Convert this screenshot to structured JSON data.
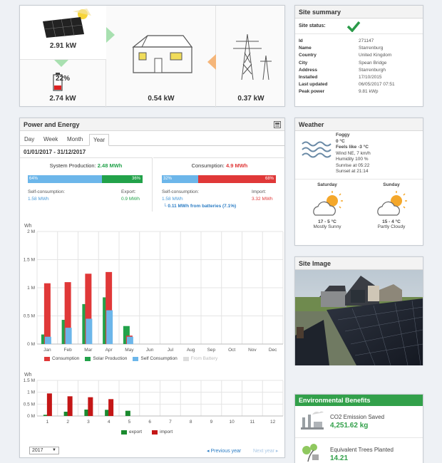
{
  "flow": {
    "solar_kw": "2.91 kW",
    "battery_pct": "22%",
    "battery_kw": "2.74 kW",
    "home_kw": "0.54 kW",
    "grid_kw": "0.37 kW"
  },
  "summary": {
    "title": "Site summary",
    "status_label": "Site status:",
    "rows": [
      {
        "k": "Id",
        "v": "271147"
      },
      {
        "k": "Name",
        "v": "Starrenburg"
      },
      {
        "k": "Country",
        "v": "United Kingdom"
      },
      {
        "k": "City",
        "v": "Spean Bridge"
      },
      {
        "k": "Address",
        "v": "Starrenburgh"
      },
      {
        "k": "Installed",
        "v": "17/10/2015"
      },
      {
        "k": "Last updated",
        "v": "06/05/2017 07:51"
      },
      {
        "k": "Peak power",
        "v": "9.81 kWp"
      }
    ]
  },
  "power": {
    "title": "Power and Energy",
    "tabs": [
      "Day",
      "Week",
      "Month",
      "Year"
    ],
    "date_range": "01/01/2017 - 31/12/2017",
    "production_label": "System Production:",
    "production_value": "2.48 MWh",
    "consumption_label": "Consumption:",
    "consumption_value": "4.9 MWh",
    "prod_split": [
      "64%",
      "36%"
    ],
    "cons_split": [
      "32%",
      "68%"
    ],
    "self_cons_label": "Self-consumption:",
    "self_cons_value": "1.58 MWh",
    "export_label": "Export:",
    "export_value": "0.9 MWh",
    "self_cons_label2": "Self-consumption:",
    "self_cons_value2": "1.58 MWh",
    "import_label": "Import:",
    "import_value": "3.32 MWh",
    "from_batteries": "0.11 MWh from batteries (7.1%)",
    "year_select": "2017",
    "prev_year": "Previous year",
    "next_year": "Next year"
  },
  "chart_data": [
    {
      "type": "bar",
      "ylabel": "Wh",
      "categories": [
        "Jan",
        "Feb",
        "Mar",
        "Apr",
        "May",
        "Jun",
        "Jul",
        "Aug",
        "Sep",
        "Oct",
        "Nov",
        "Dec"
      ],
      "yticks": [
        "0 M",
        "0.5 M",
        "1 M",
        "1.5 M",
        "2 M"
      ],
      "ylim": [
        0,
        2000000
      ],
      "series": [
        {
          "name": "Consumption",
          "color": "#e03838",
          "values": [
            1080000,
            1100000,
            1250000,
            1280000,
            150000,
            0,
            0,
            0,
            0,
            0,
            0,
            0
          ]
        },
        {
          "name": "Solar Production",
          "color": "#22a24a",
          "values": [
            170000,
            430000,
            710000,
            830000,
            320000,
            0,
            0,
            0,
            0,
            0,
            0,
            0
          ]
        },
        {
          "name": "Self Consumption",
          "color": "#6cb6ea",
          "values": [
            130000,
            290000,
            450000,
            600000,
            130000,
            0,
            0,
            0,
            0,
            0,
            0,
            0
          ]
        },
        {
          "name": "From Battery",
          "color": "#cccccc",
          "values": [
            0,
            0,
            0,
            0,
            0,
            0,
            0,
            0,
            0,
            0,
            0,
            0
          ]
        }
      ]
    },
    {
      "type": "bar",
      "ylabel": "Wh",
      "categories": [
        "1",
        "2",
        "3",
        "4",
        "5",
        "6",
        "7",
        "8",
        "9",
        "10",
        "11",
        "12"
      ],
      "yticks": [
        "0 M",
        "0.5 M",
        "1 M",
        "1.5 M"
      ],
      "ylim": [
        0,
        1500000
      ],
      "series": [
        {
          "name": "export",
          "color": "#1a8a2e",
          "values": [
            50000,
            180000,
            270000,
            260000,
            220000,
            0,
            0,
            0,
            0,
            0,
            0,
            0
          ]
        },
        {
          "name": "import",
          "color": "#c41616",
          "values": [
            950000,
            830000,
            790000,
            710000,
            0,
            0,
            0,
            0,
            0,
            0,
            0,
            0
          ]
        }
      ]
    }
  ],
  "weather": {
    "title": "Weather",
    "condition": "Foggy",
    "temp": "0 °C",
    "feels": "Feels like -3 °C",
    "wind": "Wind NE, 7 km/h",
    "humidity": "Humidity 100 %",
    "sunrise": "Sunrise at 05:22",
    "sunset": "Sunset at 21:14",
    "forecast": [
      {
        "day": "Saturday",
        "temp": "17 - 5 °C",
        "desc": "Mostly Sunny"
      },
      {
        "day": "Sunday",
        "temp": "15 - 4 °C",
        "desc": "Partly Cloudy"
      }
    ]
  },
  "site_image": {
    "title": "Site Image"
  },
  "env": {
    "title": "Environmental Benefits",
    "co2_label": "CO2 Emission Saved",
    "co2_value": "4,251.62 kg",
    "trees_label": "Equivalent Trees Planted",
    "trees_value": "14.21"
  },
  "colors": {
    "green": "#32a04a",
    "red": "#e03838",
    "blue": "#6cb6ea"
  }
}
